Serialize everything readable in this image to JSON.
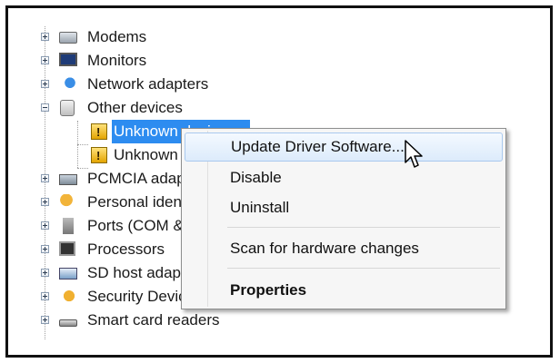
{
  "tree": {
    "items": [
      {
        "label": "Modems",
        "icon": "modem-icon"
      },
      {
        "label": "Monitors",
        "icon": "monitor-icon"
      },
      {
        "label": "Network adapters",
        "icon": "network-adapter-icon"
      },
      {
        "label": "Other devices",
        "icon": "other-devices-icon"
      },
      {
        "label": "Unknown device",
        "icon": "unknown-device-warning-icon"
      },
      {
        "label": "Unknown device",
        "icon": "unknown-device-warning-icon"
      },
      {
        "label": "PCMCIA adapters",
        "icon": "pcmcia-icon"
      },
      {
        "label": "Personal identification devices",
        "icon": "personal-id-icon"
      },
      {
        "label": "Ports (COM & LPT)",
        "icon": "ports-icon"
      },
      {
        "label": "Processors",
        "icon": "processor-icon"
      },
      {
        "label": "SD host adapters",
        "icon": "sd-host-icon"
      },
      {
        "label": "Security Devices",
        "icon": "security-device-icon"
      },
      {
        "label": "Smart card readers",
        "icon": "smart-card-icon"
      }
    ]
  },
  "context_menu": {
    "update_driver": "Update Driver Software...",
    "disable": "Disable",
    "uninstall": "Uninstall",
    "scan": "Scan for hardware changes",
    "properties": "Properties"
  },
  "colors": {
    "selection": "#2d8cf0",
    "menu_highlight": "#dcebfb"
  }
}
